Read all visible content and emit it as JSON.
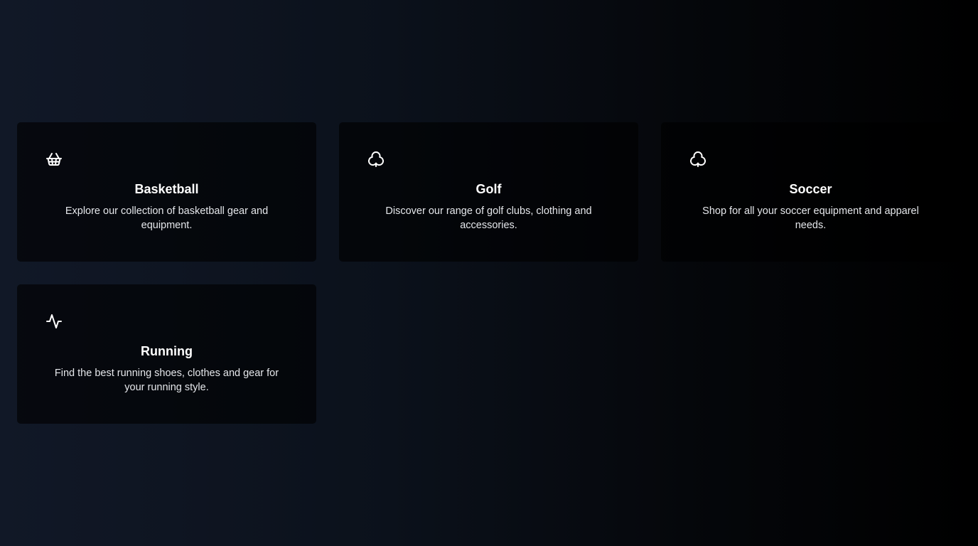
{
  "categories": [
    {
      "icon": "basket-icon",
      "title": "Basketball",
      "description": "Explore our collection of basketball gear and equipment."
    },
    {
      "icon": "club-icon",
      "title": "Golf",
      "description": "Discover our range of golf clubs, clothing and accessories."
    },
    {
      "icon": "club-icon",
      "title": "Soccer",
      "description": "Shop for all your soccer equipment and apparel needs."
    },
    {
      "icon": "activity-icon",
      "title": "Running",
      "description": "Find the best running shoes, clothes and gear for your running style."
    }
  ],
  "colors": {
    "background_start": "#111827",
    "background_end": "#000000",
    "card_background": "#05070b",
    "text": "#ffffff",
    "description_text": "#e5e7eb"
  }
}
